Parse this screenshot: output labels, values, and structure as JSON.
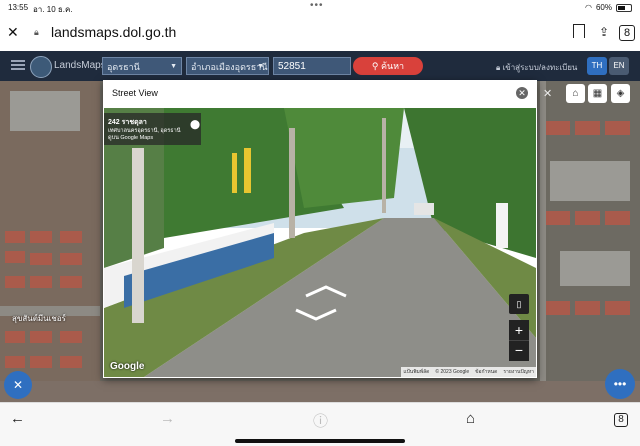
{
  "status": {
    "time": "13:55",
    "date": "อา. 10 ธ.ค.",
    "dots": "•••",
    "battery": "60%"
  },
  "browser": {
    "url": "landsmaps.dol.go.th",
    "tabs_count": "8"
  },
  "app": {
    "brand": "LandsMaps",
    "province": "อุดรธานี",
    "district": "อำเภอเมืองอุดรธานี",
    "parcel_no": "52851",
    "search_label": "ค้นหา",
    "login_label": "เข้าสู่ระบบ/ลงทะเบียน",
    "lang_th": "TH",
    "lang_en": "EN"
  },
  "map": {
    "label": "สุขสันต์มีนเชอร์"
  },
  "street_view": {
    "title": "Street View",
    "address": "242 ราชดุลา",
    "subtitle": "เทศบาลนครอุดรธานี, อุดรธานี",
    "source": "ดูบน Google Maps",
    "google_logo": "Google",
    "footer": [
      "แป้นพิมพ์ลัด",
      "© 2023 Google",
      "ข้อกำหนด",
      "รายงานปัญหา"
    ]
  },
  "colors": {
    "header_bg": "#1f2b3d",
    "search_btn": "#d9413b",
    "accent": "#2f6fc0"
  }
}
